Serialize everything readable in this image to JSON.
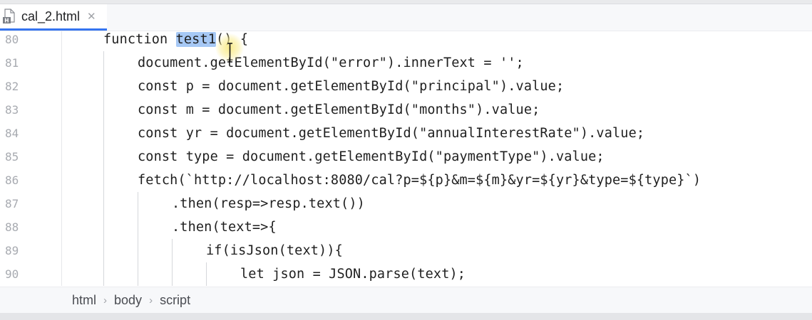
{
  "tab": {
    "filename": "cal_2.html",
    "close_glyph": "✕"
  },
  "editor": {
    "lines": [
      {
        "num": "80",
        "pre": "function ",
        "hl": "test1",
        "post": "() {"
      },
      {
        "num": "81",
        "text": "document.getElementById(\"error\").innerText = '';"
      },
      {
        "num": "82",
        "text": "const p = document.getElementById(\"principal\").value;"
      },
      {
        "num": "83",
        "text": "const m = document.getElementById(\"months\").value;"
      },
      {
        "num": "84",
        "text": "const yr = document.getElementById(\"annualInterestRate\").value;"
      },
      {
        "num": "85",
        "text": "const type = document.getElementById(\"paymentType\").value;"
      },
      {
        "num": "86",
        "text": "fetch(`http://localhost:8080/cal?p=${p}&m=${m}&yr=${yr}&type=${type}`)"
      },
      {
        "num": "87",
        "text": ".then(resp=>resp.text())"
      },
      {
        "num": "88",
        "text": ".then(text=>{"
      },
      {
        "num": "89",
        "text": "if(isJson(text)){"
      },
      {
        "num": "90",
        "text": "let json = JSON.parse(text);"
      }
    ]
  },
  "breadcrumb": {
    "items": [
      "html",
      "body",
      "script"
    ],
    "separator": "›"
  },
  "colors": {
    "accent": "#3574f0",
    "selection": "#a6c8f5",
    "line_number": "#a8abb1"
  }
}
